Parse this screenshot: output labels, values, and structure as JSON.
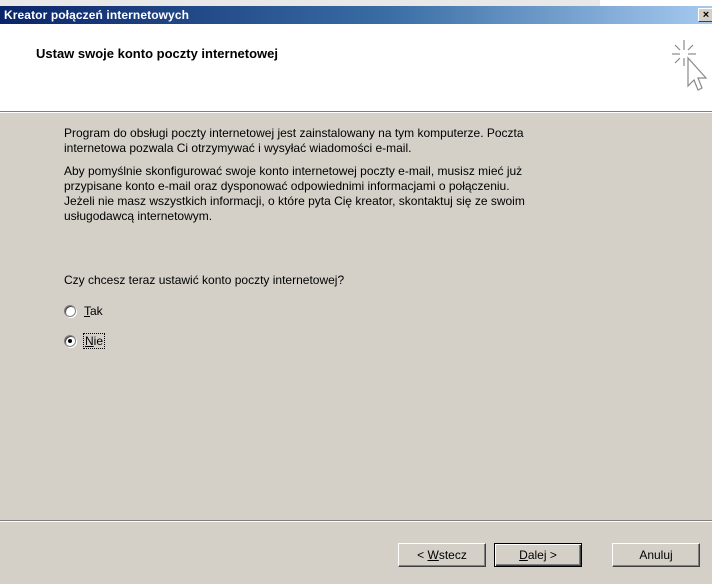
{
  "window": {
    "title": "Kreator połączeń internetowych",
    "close_glyph": "×"
  },
  "header": {
    "heading": "Ustaw swoje konto poczty internetowej",
    "icon": "wizard-cursor-icon"
  },
  "content": {
    "paragraph1_line1": "Program do obsługi poczty internetowej jest zainstalowany na tym komputerze. Poczta",
    "paragraph1_line2": "internetowa pozwala Ci otrzymywać i wysyłać wiadomości e-mail.",
    "paragraph2_line1": "Aby pomyślnie skonfigurować swoje konto internetowej poczty e-mail, musisz mieć już",
    "paragraph2_line2": "przypisane konto e-mail oraz dysponować odpowiednimi informacjami o połączeniu.",
    "paragraph2_line3": "Jeżeli nie masz wszystkich informacji, o które pyta Cię kreator, skontaktuj się ze swoim",
    "paragraph2_line4": "usługodawcą internetowym.",
    "question": "Czy chcesz teraz ustawić konto poczty internetowej?"
  },
  "options": [
    {
      "mnemonic": "T",
      "rest": "ak",
      "checked": false
    },
    {
      "mnemonic": "N",
      "rest": "ie",
      "checked": true
    }
  ],
  "buttons": {
    "back_prefix": "< ",
    "back_mnemonic": "W",
    "back_rest": "stecz",
    "next_mnemonic": "D",
    "next_rest": "alej >",
    "cancel": "Anuluj"
  }
}
